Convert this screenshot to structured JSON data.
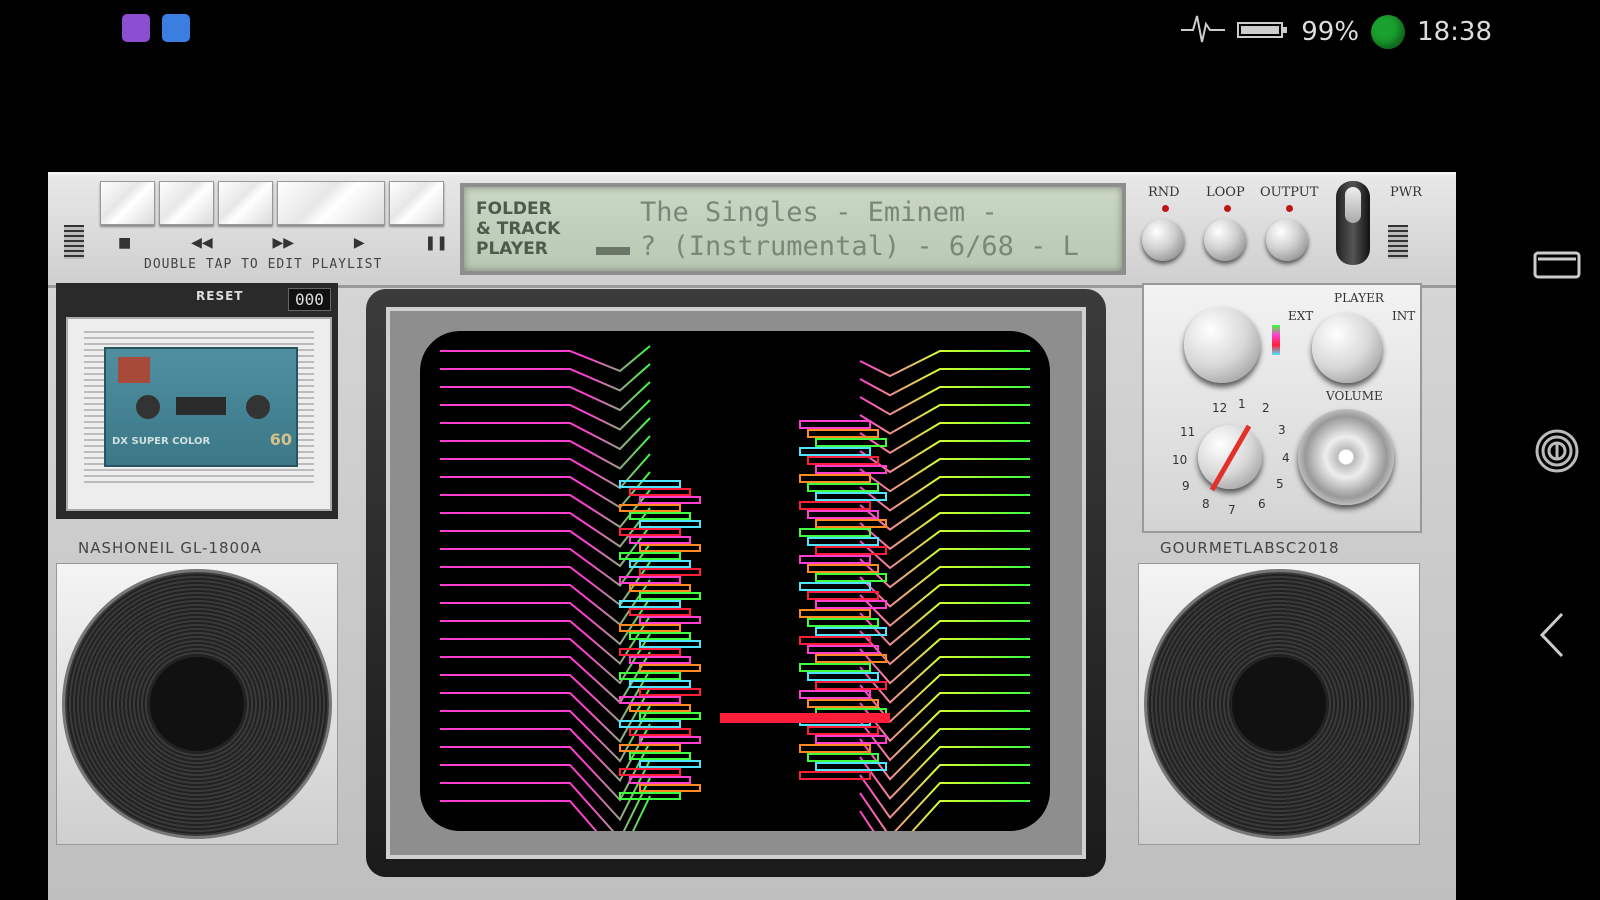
{
  "status_bar": {
    "battery": "99%",
    "time": "18:38",
    "notification_icons": [
      "app-purple-icon",
      "message-blue-icon"
    ],
    "icons": [
      "pulse-icon",
      "battery-icon",
      "status-dot"
    ]
  },
  "nav_bar": {
    "icons": [
      "recent-apps-icon",
      "fingerprint-icon",
      "back-icon"
    ]
  },
  "player": {
    "transport": {
      "stop": "■",
      "rewind": "◀◀",
      "forward": "▶▶",
      "play": "▶",
      "pause": "❚❚"
    },
    "hint": "DOUBLE TAP TO EDIT PLAYLIST",
    "lcd": {
      "label_line1": "FOLDER",
      "label_line2": "& TRACK",
      "label_line3": "PLAYER",
      "line1": "The Singles - Eminem -",
      "line2": "? (Instrumental) - 6/68 - L"
    },
    "controls": {
      "rnd": "RND",
      "loop": "LOOP",
      "output": "OUTPUT",
      "pwr": "PWR"
    },
    "cassette": {
      "reset": "RESET",
      "counter": "000",
      "tape_text": "DX SUPER COLOR",
      "tape_side": "60"
    },
    "brand_left": "NASHONEIL GL-1800A",
    "brand_right": "GOURMETLABSC2018",
    "right_panel": {
      "player_label": "PLAYER",
      "ext": "EXT",
      "int": "INT",
      "volume": "VOLUME",
      "dial_numbers": [
        "12",
        "1",
        "2",
        "3",
        "4",
        "5",
        "6",
        "7",
        "8",
        "9",
        "10",
        "11"
      ]
    }
  },
  "colors": {
    "magenta": "#ff3fd0",
    "green": "#3dff40",
    "red": "#ff1e3a",
    "cyan": "#4fe4ff",
    "lcd_bg": "#c3d2be"
  }
}
